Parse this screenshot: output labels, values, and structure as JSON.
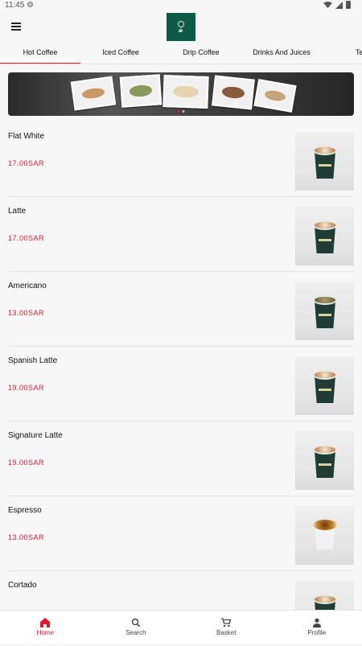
{
  "status_bar": {
    "time": "11:45"
  },
  "tabs": [
    {
      "label": "Hot Coffee",
      "active": true
    },
    {
      "label": "Iced Coffee",
      "active": false
    },
    {
      "label": "Drip Coffee",
      "active": false
    },
    {
      "label": "Drinks And Juices",
      "active": false
    },
    {
      "label": "Te",
      "active": false
    }
  ],
  "banner": {
    "dots": 2,
    "active_dot": 0
  },
  "menu_items": [
    {
      "name": "Flat White",
      "price": "17.00SAR",
      "image": "latte-cup"
    },
    {
      "name": "Latte",
      "price": "17.00SAR",
      "image": "latte-cup"
    },
    {
      "name": "Americano",
      "price": "13.00SAR",
      "image": "americano-cup"
    },
    {
      "name": "Spanish Latte",
      "price": "19.00SAR",
      "image": "latte-cup"
    },
    {
      "name": "Signature Latte",
      "price": "19.00SAR",
      "image": "latte-cup"
    },
    {
      "name": "Espresso",
      "price": "13.00SAR",
      "image": "espresso-cup"
    },
    {
      "name": "Cortado",
      "price": "",
      "image": "latte-cup"
    }
  ],
  "bottom_nav": [
    {
      "label": "Home",
      "icon": "home-icon",
      "active": true
    },
    {
      "label": "Search",
      "icon": "search-icon",
      "active": false
    },
    {
      "label": "Basket",
      "icon": "basket-icon",
      "active": false
    },
    {
      "label": "Profile",
      "icon": "profile-icon",
      "active": false
    }
  ],
  "colors": {
    "accent": "#e01831",
    "brand": "#0d5a47",
    "background": "#f7f7f7"
  }
}
